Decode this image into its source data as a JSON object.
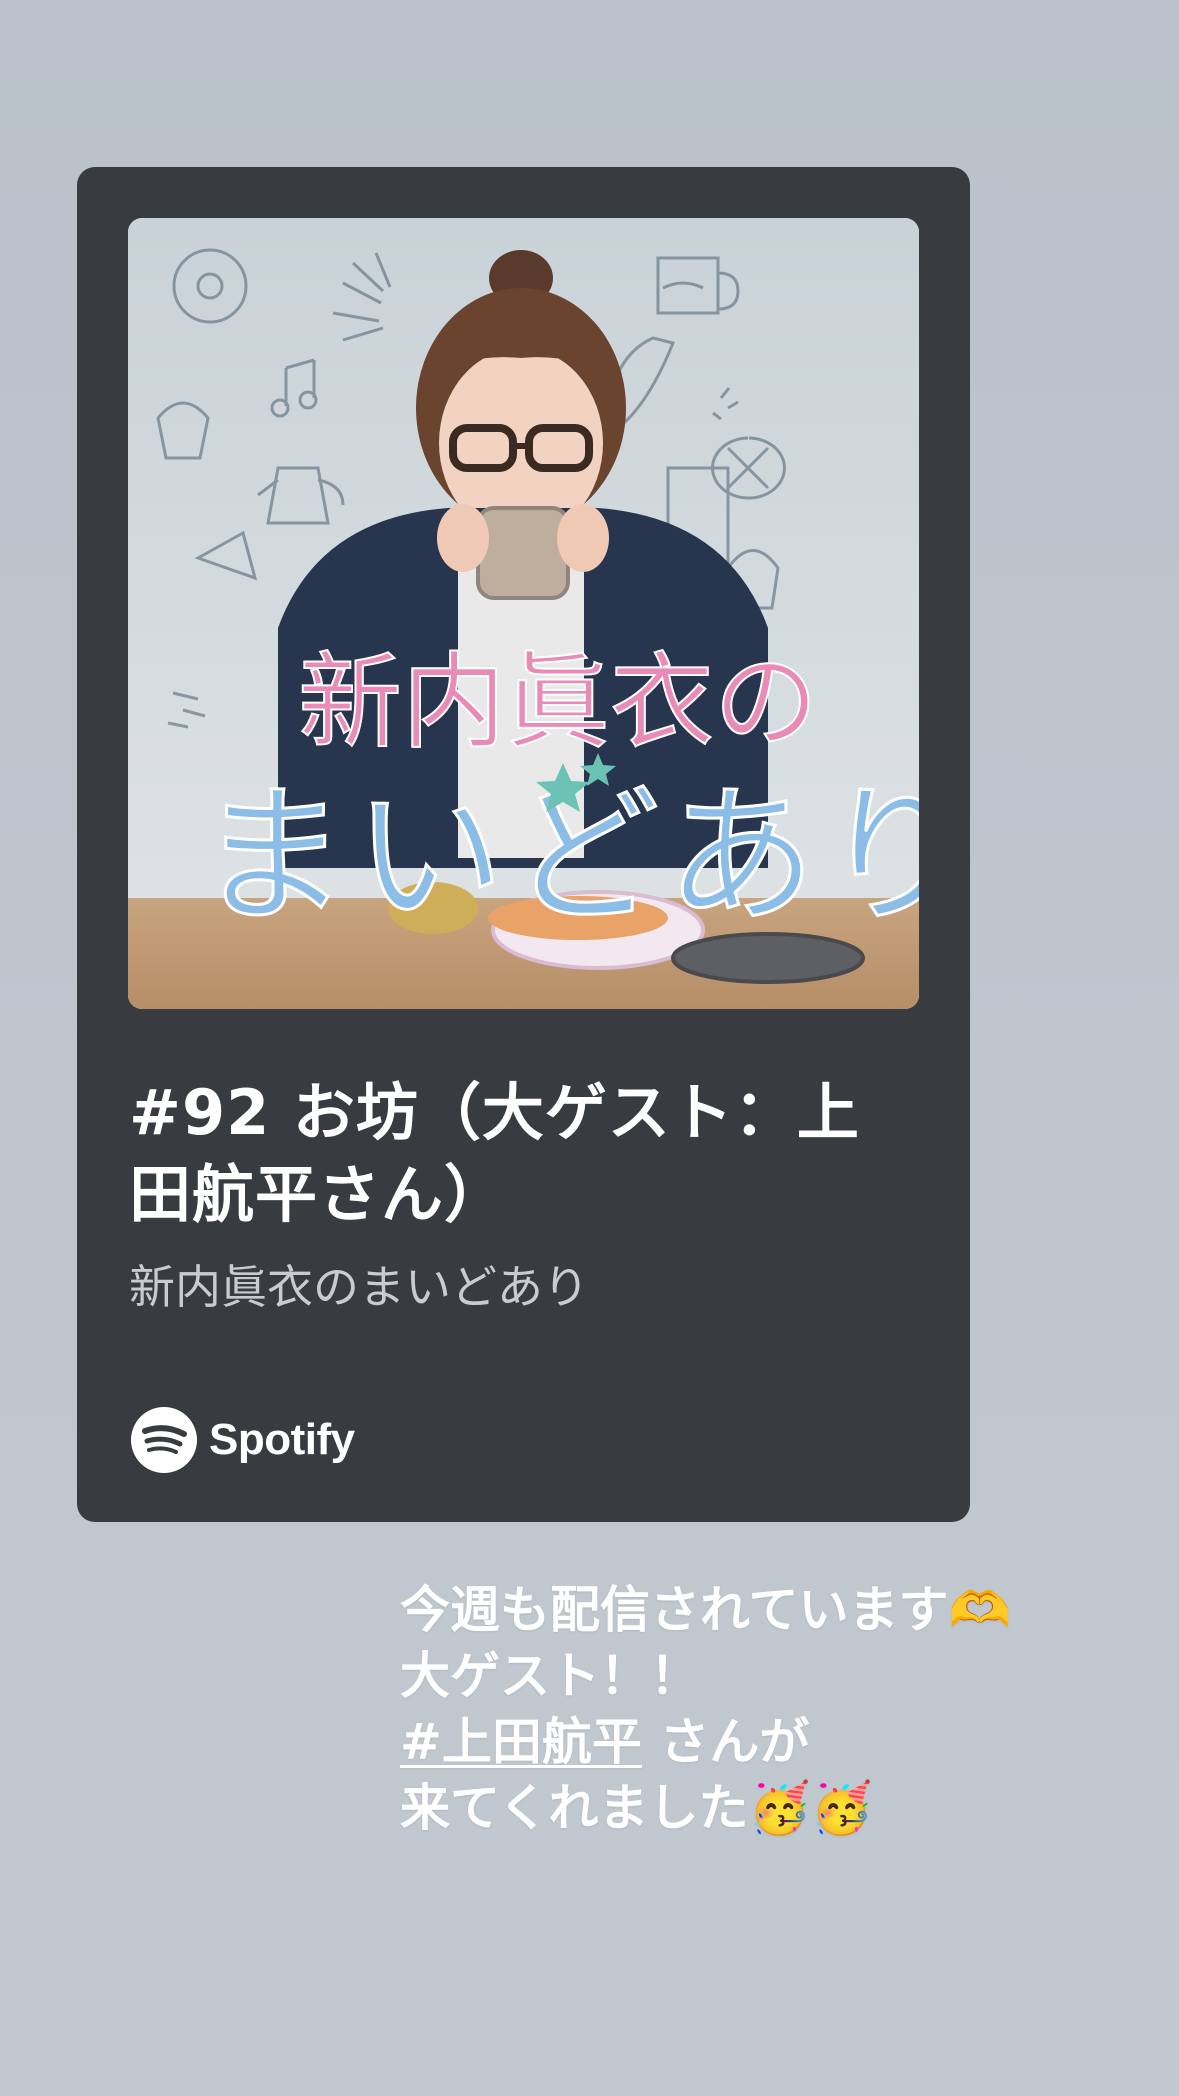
{
  "card": {
    "episode_title": "#92 お坊（大ゲスト：上田航平さん）",
    "show_name": "新内眞衣のまいどあり",
    "platform": "Spotify",
    "cover_art_title_line1": "新内眞衣の",
    "cover_art_title_line2": "まいどあり"
  },
  "caption": {
    "line1_text": "今週も配信されています",
    "line1_emoji": "🫶",
    "line2": "大ゲスト！！",
    "line3_hashtag": "#上田航平",
    "line3_rest": " さんが",
    "line4_text": "来てくれました",
    "line4_emoji": "🥳🥳"
  },
  "colors": {
    "background": "#bfc5cd",
    "card": "#383b3f",
    "title_text": "#ffffff",
    "subtitle_text": "#c9cbce",
    "cover_accent_pink": "#e88bb6",
    "cover_accent_teal": "#6cc3b5",
    "cover_accent_yellow": "#f0cc6a",
    "cover_accent_blue": "#8bbde6"
  },
  "icons": [
    "spotify-logo-icon"
  ]
}
